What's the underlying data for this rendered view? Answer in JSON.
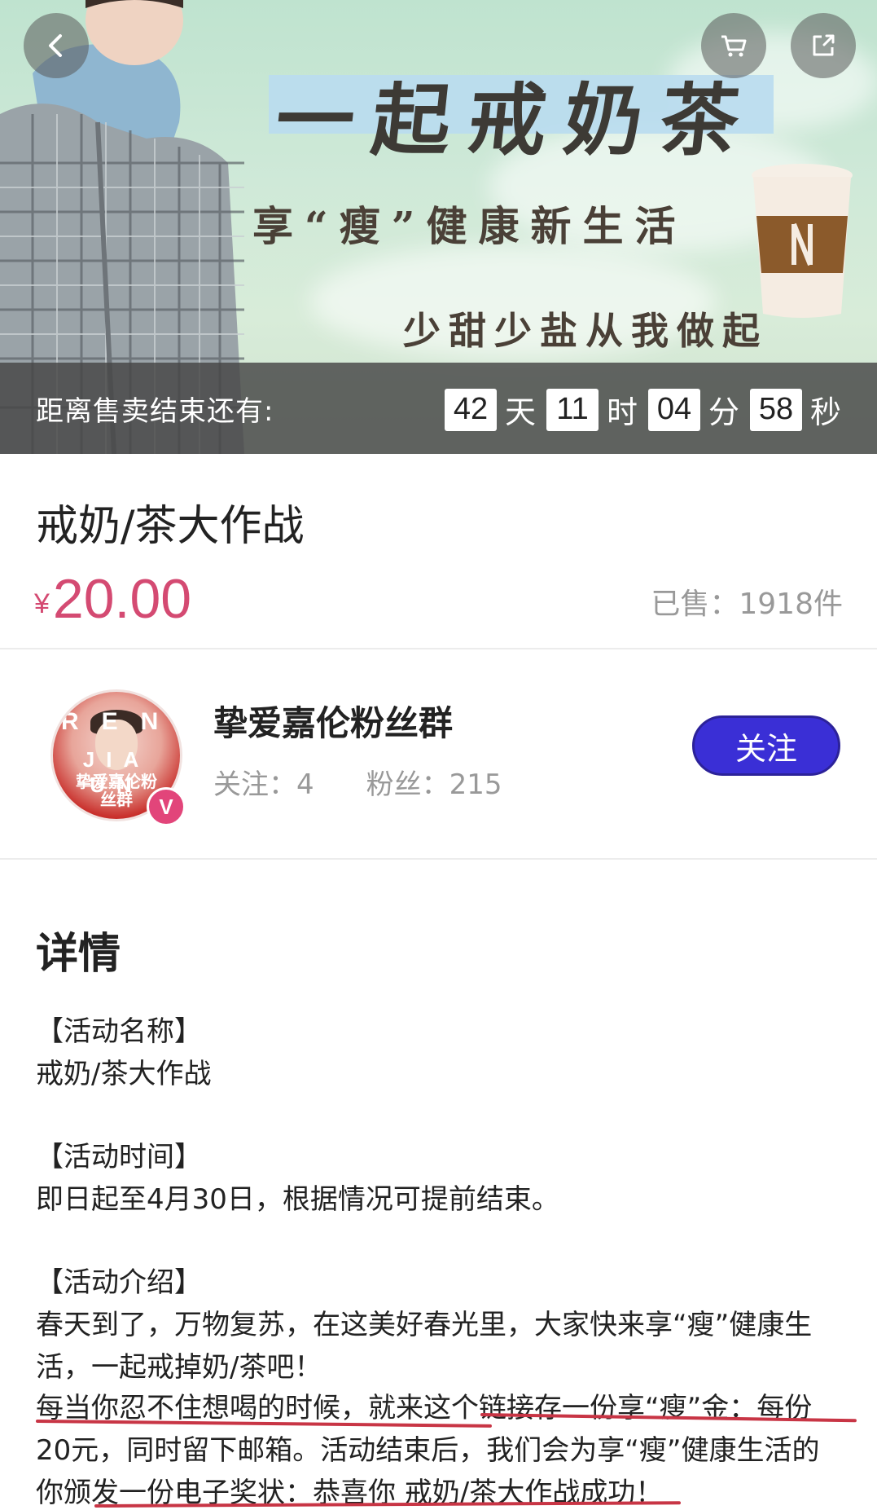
{
  "hero": {
    "title": "一起戒奶茶",
    "subtitle": "享“瘦”健康新生活",
    "slogan": "少甜少盐从我做起"
  },
  "nav": {
    "back_icon": "back-icon",
    "cart_icon": "cart-icon",
    "share_icon": "share-icon"
  },
  "countdown": {
    "label": "距离售卖结束还有:",
    "days": "42",
    "days_unit": "天",
    "hours": "11",
    "hours_unit": "时",
    "minutes": "04",
    "minutes_unit": "分",
    "seconds": "58",
    "seconds_unit": "秒"
  },
  "product": {
    "title": "戒奶/茶大作战",
    "price_symbol": "¥",
    "price": "20.00",
    "sold": "已售：1918件"
  },
  "shop": {
    "name": "挚爱嘉伦粉丝群",
    "following": "关注：4",
    "fans": "粉丝：215",
    "follow_label": "关注",
    "avatar_text_top": "REN",
    "avatar_text_mid": "JIA UN",
    "avatar_text_bottom": "挚爱嘉伦粉丝群",
    "badge": "V"
  },
  "details": {
    "title": "详情",
    "lines": [
      "【活动名称】",
      "戒奶/茶大作战",
      "【活动时间】",
      "即日起至4月30日，根据情况可提前结束。",
      "【活动介绍】",
      "春天到了，万物复苏，在这美好春光里，大家快来享“瘦”健康生",
      "活，一起戒掉奶/茶吧！",
      "每当你忍不住想喝的时候，就来这个链接存一份享“瘦”金：每份",
      "20元，同时留下邮箱。活动结束后，我们会为享“瘦”健康生活的",
      "你颁发一份电子奖状：恭喜你 戒奶/茶大作战成功！"
    ]
  },
  "colors": {
    "price": "#d44a72",
    "follow_button": "#3a2fd6",
    "underline": "#c83545",
    "countdown_bar": "#464646"
  }
}
